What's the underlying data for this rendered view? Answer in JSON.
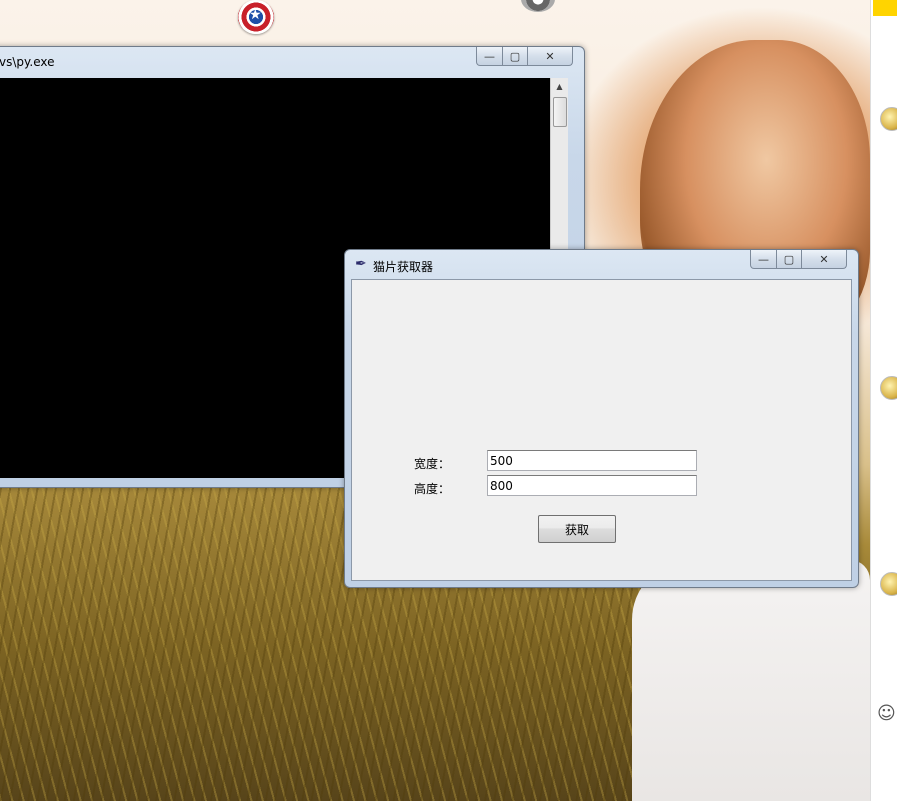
{
  "desktop": {
    "icons": [
      "captain-america-shield-icon",
      "gray-app-icon"
    ],
    "side_panel": {
      "icons": [
        "avatar-icon",
        "avatar-icon",
        "avatar-icon",
        "smiley-icon"
      ],
      "smiley_glyph": "☺"
    }
  },
  "console_window": {
    "title": "vs\\py.exe",
    "buttons": {
      "minimize": "—",
      "maximize": "▢",
      "close": "✕"
    }
  },
  "tk_window": {
    "icon": "feather-icon",
    "title": "猫片获取器",
    "buttons": {
      "minimize": "—",
      "maximize": "▢",
      "close": "✕"
    },
    "width_label": "宽度：",
    "width_value": "500",
    "height_label": "高度：",
    "height_value": "800",
    "fetch_button_label": "获取"
  },
  "colors": {
    "console_bg": "#000000",
    "client_bg": "#f0f0f0",
    "accent_yellow": "#ffd400"
  }
}
